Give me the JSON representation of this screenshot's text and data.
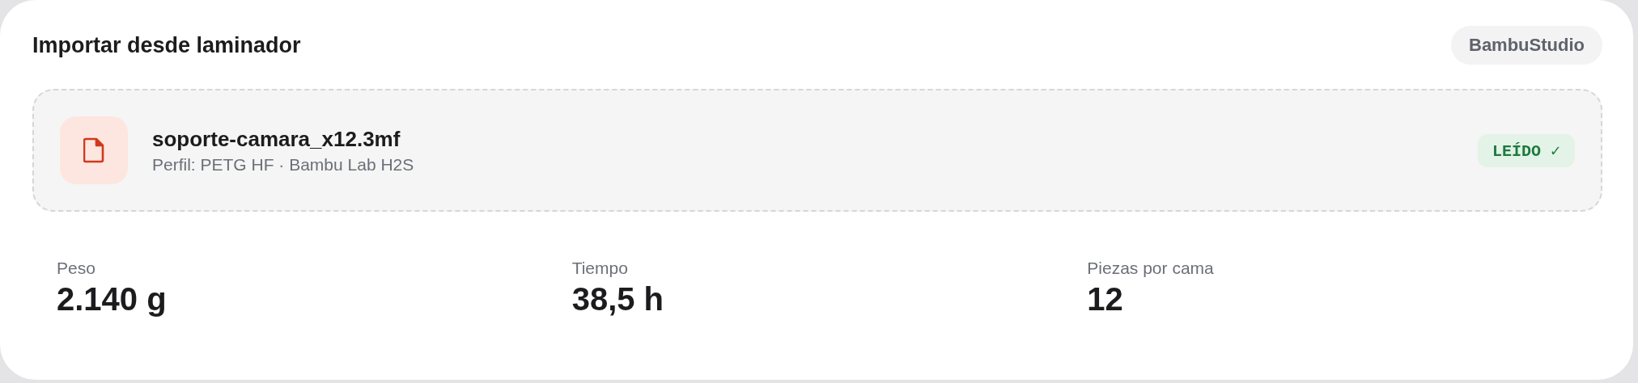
{
  "card": {
    "title": "Importar desde laminador",
    "source_badge": "BambuStudio"
  },
  "file": {
    "name": "soporte-camara_x12.3mf",
    "profile": "Perfil: PETG HF · Bambu Lab H2S",
    "status": "LEÍDO ✓"
  },
  "stats": [
    {
      "label": "Peso",
      "value": "2.140 g"
    },
    {
      "label": "Tiempo",
      "value": "38,5 h"
    },
    {
      "label": "Piezas por cama",
      "value": "12"
    }
  ]
}
